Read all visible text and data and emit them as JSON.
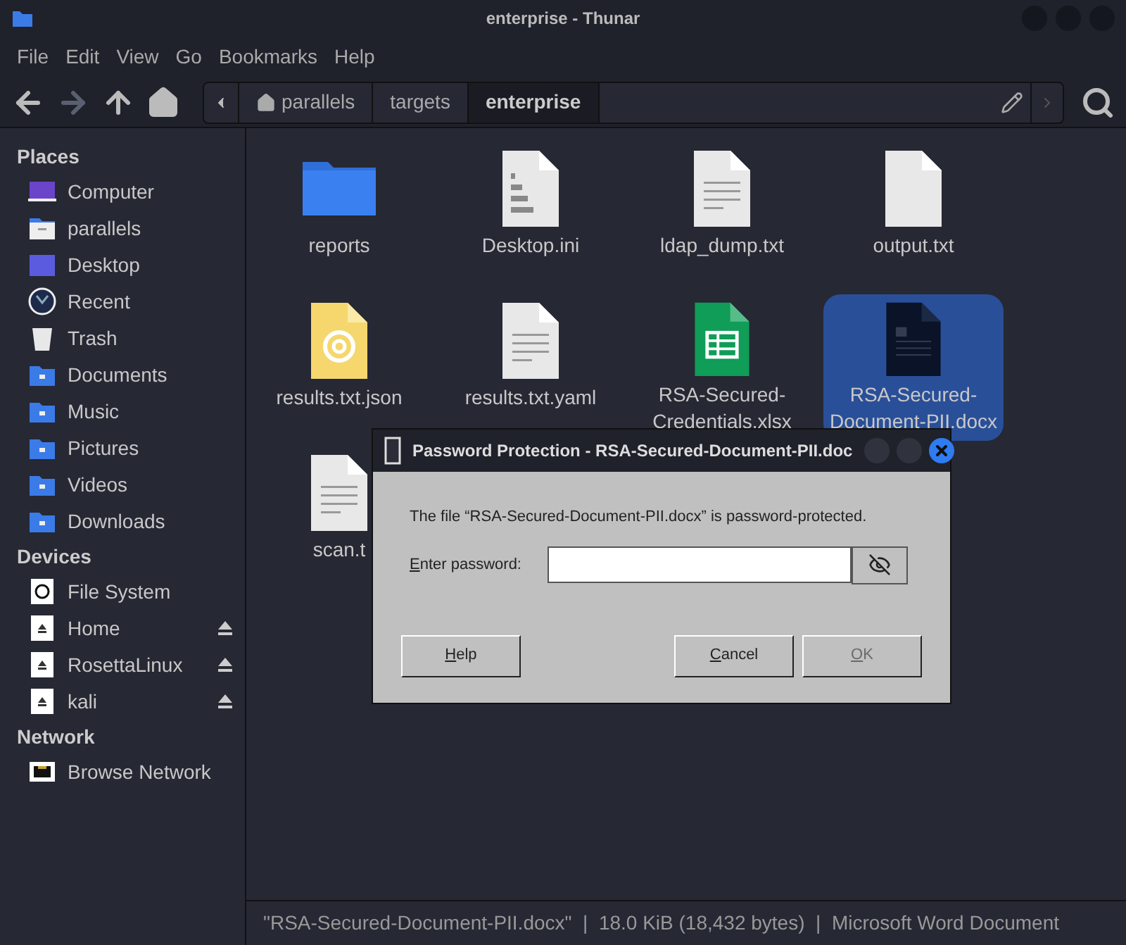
{
  "window": {
    "title": "enterprise - Thunar"
  },
  "menu": [
    "File",
    "Edit",
    "View",
    "Go",
    "Bookmarks",
    "Help"
  ],
  "path": [
    {
      "label": "parallels",
      "home": true,
      "selected": false
    },
    {
      "label": "targets",
      "home": false,
      "selected": false
    },
    {
      "label": "enterprise",
      "home": false,
      "selected": true
    }
  ],
  "sidebar": [
    {
      "heading": "Places",
      "items": [
        {
          "label": "Computer",
          "kind": "computer",
          "ejectable": false
        },
        {
          "label": "parallels",
          "kind": "home",
          "ejectable": false
        },
        {
          "label": "Desktop",
          "kind": "desktop",
          "ejectable": false
        },
        {
          "label": "Recent",
          "kind": "recent",
          "ejectable": false
        },
        {
          "label": "Trash",
          "kind": "trash",
          "ejectable": false
        },
        {
          "label": "Documents",
          "kind": "folder",
          "ejectable": false
        },
        {
          "label": "Music",
          "kind": "folder",
          "ejectable": false
        },
        {
          "label": "Pictures",
          "kind": "folder",
          "ejectable": false
        },
        {
          "label": "Videos",
          "kind": "folder",
          "ejectable": false
        },
        {
          "label": "Downloads",
          "kind": "folder",
          "ejectable": false
        }
      ]
    },
    {
      "heading": "Devices",
      "items": [
        {
          "label": "File System",
          "kind": "disk",
          "ejectable": false
        },
        {
          "label": "Home",
          "kind": "drive",
          "ejectable": true
        },
        {
          "label": "RosettaLinux",
          "kind": "drive",
          "ejectable": true
        },
        {
          "label": "kali",
          "kind": "drive",
          "ejectable": true
        }
      ]
    },
    {
      "heading": "Network",
      "items": [
        {
          "label": "Browse Network",
          "kind": "network",
          "ejectable": false
        }
      ]
    }
  ],
  "files": [
    {
      "name": "reports",
      "kind": "folder",
      "selected": false
    },
    {
      "name": "Desktop.ini",
      "kind": "binary",
      "selected": false
    },
    {
      "name": "ldap_dump.txt",
      "kind": "text",
      "selected": false
    },
    {
      "name": "output.txt",
      "kind": "blank",
      "selected": false
    },
    {
      "name": "results.txt.json",
      "kind": "json",
      "selected": false
    },
    {
      "name": "results.txt.yaml",
      "kind": "text",
      "selected": false
    },
    {
      "name": "RSA-Secured-Credentials.xlsx",
      "kind": "sheet",
      "selected": false
    },
    {
      "name": "RSA-Secured-Document-PII.docx",
      "kind": "doc",
      "selected": true
    },
    {
      "name": "scan.t",
      "kind": "text",
      "selected": false
    }
  ],
  "status_bar": "\"RSA-Secured-Document-PII.docx\"  |  18.0 KiB (18,432 bytes)  |  Microsoft Word Document",
  "dialog": {
    "title": "Password Protection - RSA-Secured-Document-PII.doc",
    "message": "The file “RSA-Secured-Document-PII.docx” is password-protected.",
    "field_label": "Enter password:",
    "buttons": [
      {
        "label": "Help",
        "disabled": false
      },
      {
        "label": "Cancel",
        "disabled": false
      },
      {
        "label": "OK",
        "disabled": true
      }
    ]
  }
}
